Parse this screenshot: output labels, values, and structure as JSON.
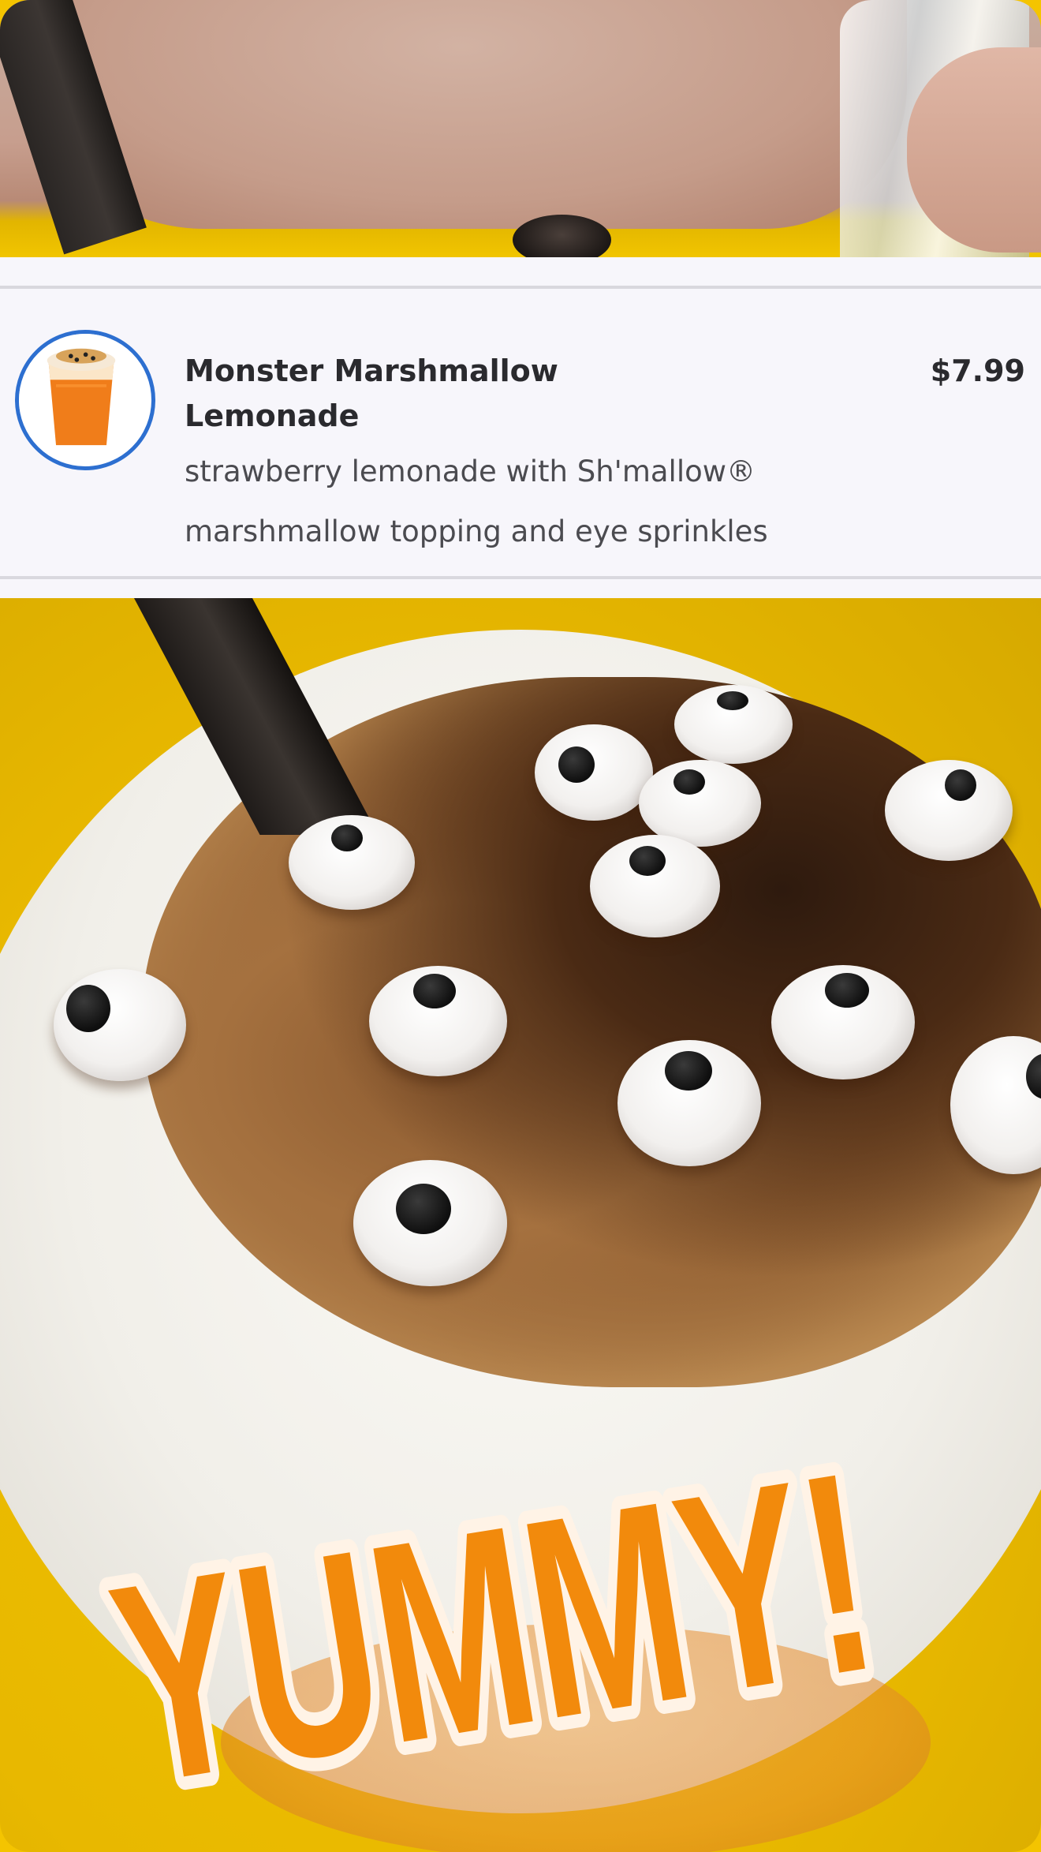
{
  "menu_item": {
    "name": "Monster Marshmallow Lemonade",
    "price": "$7.99",
    "description_line1": "strawberry lemonade with Sh'mallow®",
    "description_line2": "marshmallow topping and eye sprinkles",
    "thumbnail_icon": "drink-cup-thumbnail"
  },
  "overlay": {
    "caption": "YUMMY!",
    "caption_fill": "#f28a0c",
    "caption_outline": "#fff3e6"
  },
  "colors": {
    "accent_ring": "#2d6fd0",
    "card_background": "#f7f6fb",
    "table_yellow": "#f0c300"
  }
}
